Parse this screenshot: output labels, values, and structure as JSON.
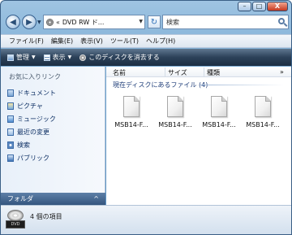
{
  "window": {
    "minimize": "–",
    "maximize": "□",
    "close": "X"
  },
  "address": {
    "back_glyph": "◀",
    "forward_glyph": "▶",
    "chevron": "«",
    "path": "DVD RW ド...",
    "refresh_glyph": "↻",
    "search_placeholder": "検索"
  },
  "menu": {
    "items": [
      "ファイル(F)",
      "編集(E)",
      "表示(V)",
      "ツール(T)",
      "ヘルプ(H)"
    ]
  },
  "commands": {
    "organize": "管理",
    "views": "表示",
    "eject": "このディスクを消去する"
  },
  "sidebar": {
    "heading": "お気に入りリンク",
    "items": [
      {
        "label": "ドキュメント",
        "icon": "documents-icon"
      },
      {
        "label": "ピクチャ",
        "icon": "pictures-icon"
      },
      {
        "label": "ミュージック",
        "icon": "music-icon"
      },
      {
        "label": "最近の変更",
        "icon": "recent-icon"
      },
      {
        "label": "検索",
        "icon": "search-icon"
      },
      {
        "label": "パブリック",
        "icon": "public-icon"
      }
    ],
    "folders_label": "フォルダ",
    "folders_chevron": "^"
  },
  "content": {
    "columns": [
      "名前",
      "サイズ",
      "種類"
    ],
    "more": "»",
    "group_title": "現在ディスクにあるファイル (4)",
    "files": [
      {
        "name": "MSB14-F..."
      },
      {
        "name": "MSB14-F..."
      },
      {
        "name": "MSB14-F..."
      },
      {
        "name": "MSB14-F..."
      }
    ]
  },
  "status": {
    "drive_label": "DVD",
    "text": "4 個の項目"
  }
}
